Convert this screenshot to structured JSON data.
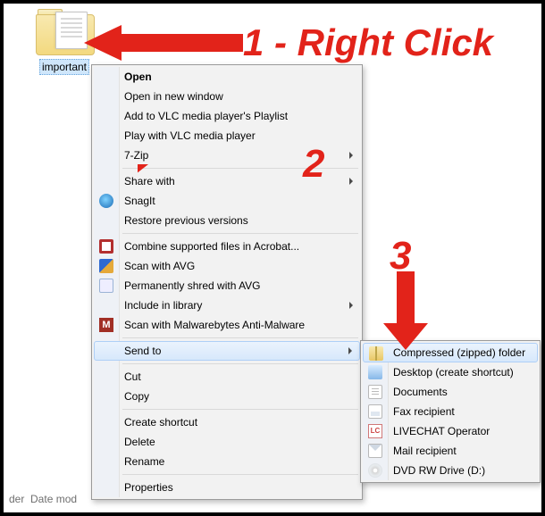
{
  "folder": {
    "label": "important"
  },
  "contextMenu": {
    "open": "Open",
    "openNew": "Open in new window",
    "vlcAdd": "Add to VLC media player's Playlist",
    "vlcPlay": "Play with VLC media player",
    "sevenZip": "7-Zip",
    "shareWith": "Share with",
    "snagit": "SnagIt",
    "restore": "Restore previous versions",
    "acrobat": "Combine supported files in Acrobat...",
    "avg": "Scan with AVG",
    "shred": "Permanently shred with AVG",
    "includeLib": "Include in library",
    "mbam": "Scan with Malwarebytes Anti-Malware",
    "sendTo": "Send to",
    "cut": "Cut",
    "copy": "Copy",
    "shortcut": "Create shortcut",
    "delete": "Delete",
    "rename": "Rename",
    "properties": "Properties"
  },
  "sendToMenu": {
    "zip": "Compressed (zipped) folder",
    "desktop": "Desktop (create shortcut)",
    "documents": "Documents",
    "fax": "Fax recipient",
    "livechat": "LIVECHAT Operator",
    "mail": "Mail recipient",
    "dvd": "DVD RW Drive (D:)"
  },
  "annotations": {
    "step1": "1 - Right Click",
    "step2": "2",
    "step3": "3"
  },
  "footer": {
    "der": "der",
    "dateMod": "Date mod"
  },
  "colors": {
    "accent": "#e2231a"
  }
}
